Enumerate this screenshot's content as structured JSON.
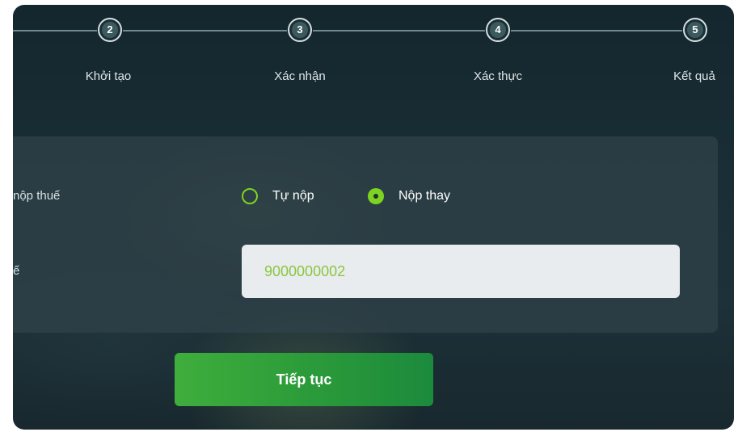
{
  "stepper": {
    "steps": [
      {
        "number": "2",
        "label": "Khởi tạo"
      },
      {
        "number": "3",
        "label": "Xác nhận"
      },
      {
        "number": "4",
        "label": "Xác thực"
      },
      {
        "number": "5",
        "label": "Kết quả"
      }
    ]
  },
  "form": {
    "payer_type_label": "nộp thuế",
    "tax_code_label": "ế",
    "options": [
      {
        "label": "Tự nộp",
        "selected": false
      },
      {
        "label": "Nộp thay",
        "selected": true
      }
    ],
    "tax_code_value": "9000000002"
  },
  "actions": {
    "continue_label": "Tiếp tục"
  },
  "colors": {
    "accent": "#7ed321",
    "button": "#2a9a3a",
    "background": "#1a2e36"
  }
}
